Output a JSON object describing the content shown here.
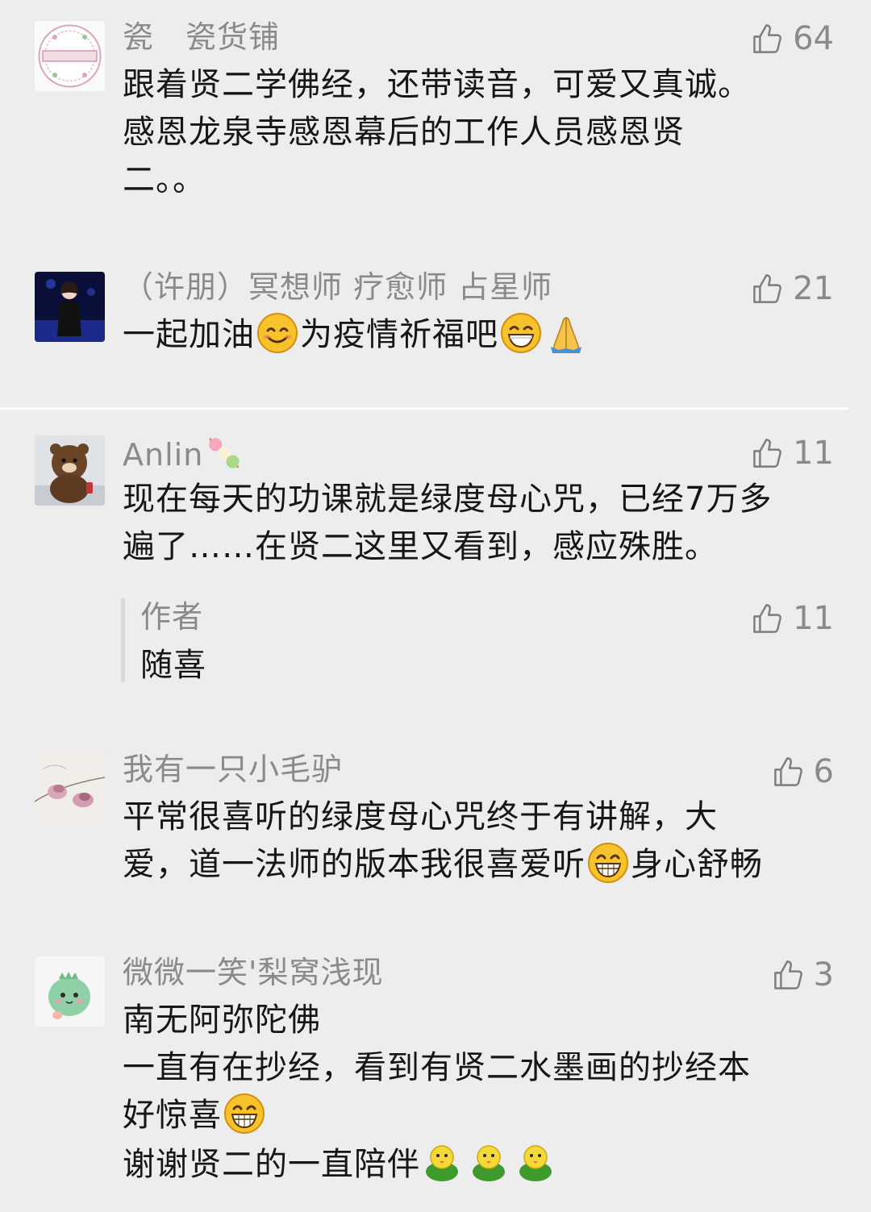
{
  "comments": [
    {
      "nickname": "瓷　瓷货铺",
      "likes": "64",
      "lines": [
        "跟着贤二学佛经，还带读音，可爱又真诚。",
        "感恩龙泉寺感恩幕后的工作人员感恩贤",
        "二。。"
      ]
    },
    {
      "nickname": "（许朋）冥想师 疗愈师 占星师",
      "likes": "21",
      "text_parts": [
        "一起加油",
        "为疫情祈福吧"
      ]
    },
    {
      "nickname": "Anlin",
      "likes": "11",
      "lines": [
        "现在每天的功课就是绿度母心咒，已经7万多",
        "遍了……在贤二这里又看到，感应殊胜。"
      ],
      "reply": {
        "author": "作者",
        "likes": "11",
        "text": "随喜"
      }
    },
    {
      "nickname": "我有一只小毛驴",
      "likes": "6",
      "line1": "平常很喜听的绿度母心咒终于有讲解，大",
      "line2_parts": [
        "爱，道一法师的版本我很喜爱听",
        "身心舒畅"
      ]
    },
    {
      "nickname": "微微一笑'梨窝浅现",
      "likes": "3",
      "line1": "南无阿弥陀佛",
      "line2": "一直有在抄经，看到有贤二水墨画的抄经本",
      "line3_parts": [
        "好惊喜"
      ],
      "line4_parts": [
        "谢谢贤二的一直陪伴"
      ]
    }
  ],
  "icons": {
    "like": "thumbs-up-icon",
    "emoji_smile": "smiling-face-emoji",
    "emoji_grin": "grinning-face-emoji",
    "emoji_pray": "folded-hands-emoji",
    "emoji_dango": "dango-emoji",
    "sticker_chick": "green-chick-sticker"
  },
  "colors": {
    "background": "#ededed",
    "nickname": "#8a8a8a",
    "text": "#161616"
  }
}
